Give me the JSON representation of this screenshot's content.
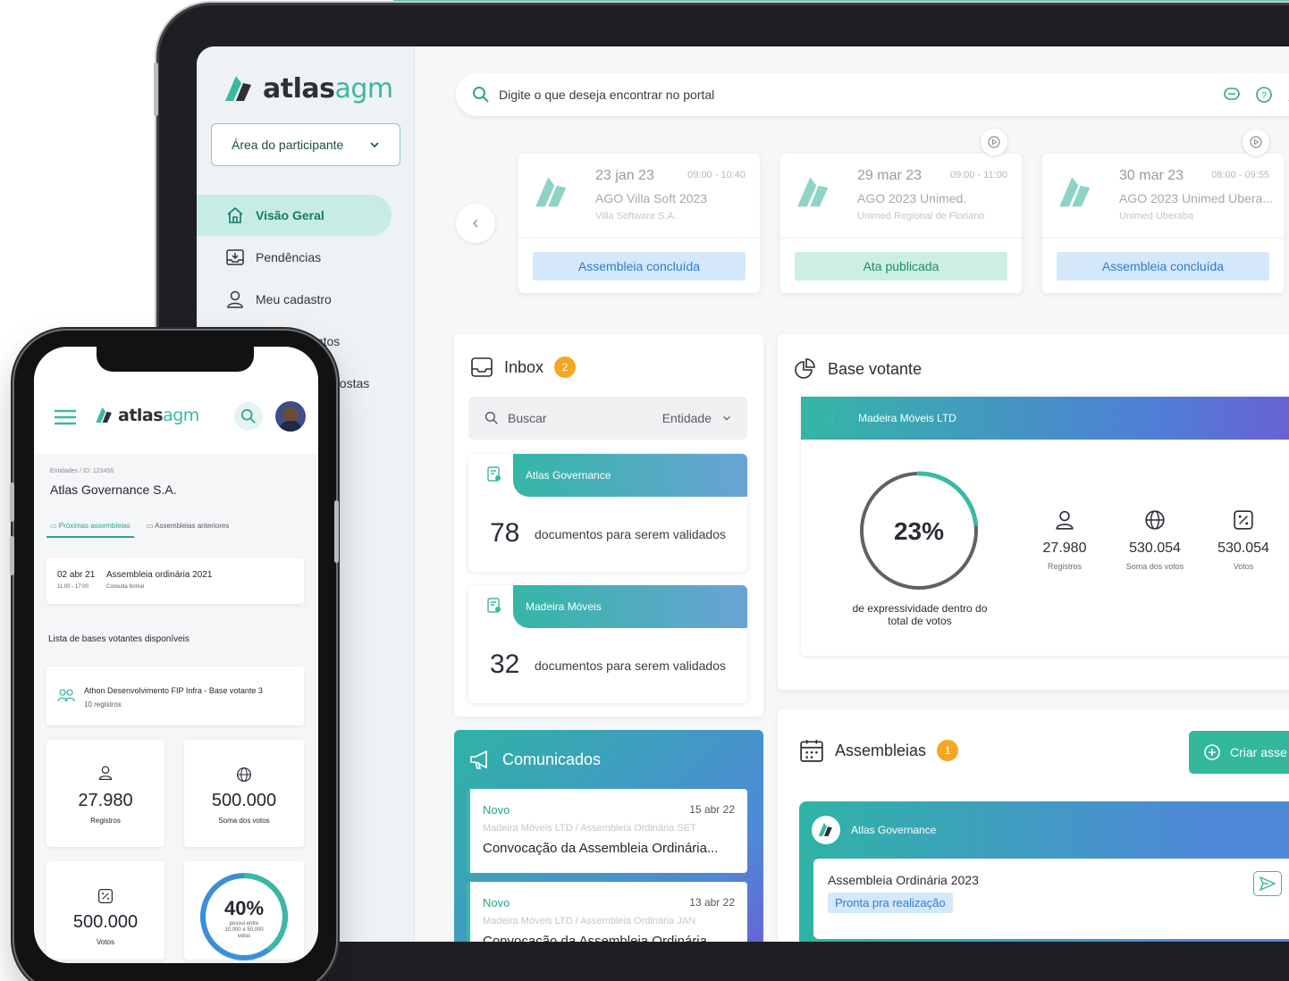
{
  "brand": {
    "name_main": "atlas",
    "name_accent": "agm"
  },
  "colors": {
    "accent": "#3bb8a2",
    "blue": "#2f7bd4",
    "orange": "#f5a623"
  },
  "sidebar": {
    "area_select": "Área do participante",
    "items": [
      {
        "label": "Visão Geral",
        "icon": "home-icon",
        "active": true
      },
      {
        "label": "Pendências",
        "icon": "inbox-download-icon"
      },
      {
        "label": "Meu cadastro",
        "icon": "user-icon"
      },
      {
        "label": "entos",
        "icon": ""
      },
      {
        "label": "postas",
        "icon": ""
      }
    ]
  },
  "search": {
    "placeholder": "Digite o que deseja encontrar no portal"
  },
  "events": [
    {
      "date": "23 jan 23",
      "time": "09:00 - 10:40",
      "title": "AGO Villa Soft 2023",
      "company": "Villa Software S.A.",
      "status": "Assembleia concluída",
      "status_type": "blue"
    },
    {
      "date": "29 mar 23",
      "time": "09:00 - 11:00",
      "title": "AGO 2023 Unimed.",
      "company": "Unimed Regional de Floriano",
      "status": "Ata publicada",
      "status_type": "green"
    },
    {
      "date": "30 mar 23",
      "time": "08:00 - 09:55",
      "title": "AGO 2023 Unimed Ubera...",
      "company": "Unimed Uberaba",
      "status": "Assembleia concluída",
      "status_type": "blue"
    }
  ],
  "inbox": {
    "title": "Inbox",
    "count": "2",
    "search_placeholder": "Buscar",
    "filter": "Entidade",
    "items": [
      {
        "entity": "Atlas Governance",
        "count": "78",
        "label": "documentos para serem validados"
      },
      {
        "entity": "Madeira Móveis",
        "count": "32",
        "label": "documentos para serem validados"
      }
    ]
  },
  "base_votante": {
    "title": "Base votante",
    "entity": "Madeira Móveis LTD",
    "percent": "23%",
    "percent_value": 0.23,
    "caption": "de expressividade dentro do total de votos",
    "metrics": [
      {
        "icon": "user-icon",
        "value": "27.980",
        "label": "Registros"
      },
      {
        "icon": "globe-icon",
        "value": "530.054",
        "label": "Soma dos votos"
      },
      {
        "icon": "percent-icon",
        "value": "530.054",
        "label": "Votos"
      }
    ]
  },
  "comunicados": {
    "title": "Comunicados",
    "items": [
      {
        "tag": "Novo",
        "date": "15 abr 22",
        "path": "Madeira Móveis LTD / Assembleia Ordinária SET",
        "title": "Convocação da Assembleia Ordinária..."
      },
      {
        "tag": "Novo",
        "date": "13 abr 22",
        "path": "Madeira Móveis LTD / Assembleia Ordinária JAN",
        "title": "Convocação da Assembleia Ordinária..."
      }
    ]
  },
  "assembleias": {
    "title": "Assembleias",
    "count": "1",
    "create_label": "Criar asse",
    "card": {
      "entity": "Atlas Governance",
      "title": "Assembleia Ordinária 2023",
      "status": "Pronta pra realização"
    }
  },
  "phone": {
    "breadcrumb": "Entidades  /  ID: 123456",
    "entity": "Atlas Governance S.A.",
    "tabs": [
      {
        "label": "Próximas assembleias",
        "active": true
      },
      {
        "label": "Assembleias anteriores"
      }
    ],
    "meeting": {
      "date": "02 abr 21",
      "time": "11:00 - 17:00",
      "title": "Assembleia ordinária 2021",
      "type": "Consulta formal"
    },
    "list_title": "Lista de bases votantes disponíveis",
    "base": {
      "name": "Athon Desenvolvimento FIP Infra - Base votante 3",
      "records": "10 registros"
    },
    "metrics": [
      {
        "icon": "user-icon",
        "value": "27.980",
        "label": "Registros"
      },
      {
        "icon": "globe-icon",
        "value": "500.000",
        "label": "Soma dos votos"
      },
      {
        "icon": "percent-icon",
        "value": "500.000",
        "label": "Votos"
      }
    ],
    "gauge": {
      "percent": "40%",
      "percent_value": 0.4,
      "caption_1": "possui entre",
      "caption_2": "10.000 e 50.000",
      "caption_3": "votos"
    }
  }
}
